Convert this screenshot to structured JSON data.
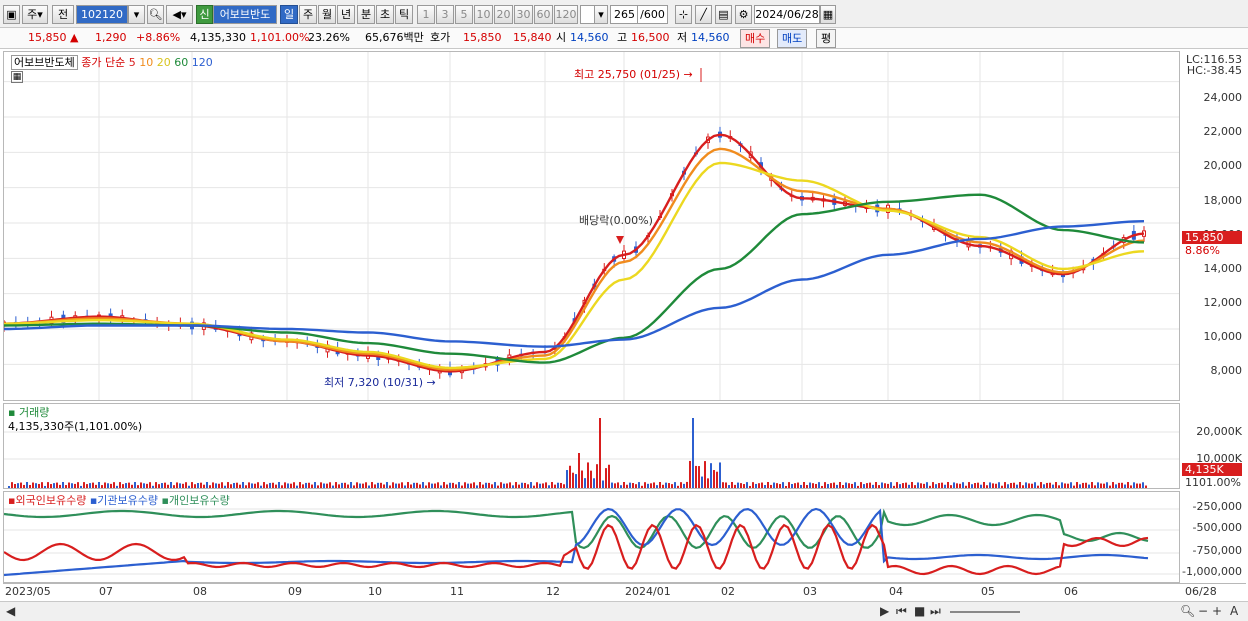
{
  "toolbar": {
    "type_label": "주",
    "period_label": "전",
    "code_value": "102120",
    "sin_label": "신",
    "stock_name": "어보브반도",
    "periods": [
      "일",
      "주",
      "월",
      "년",
      "분",
      "초",
      "틱"
    ],
    "intervals": [
      "1",
      "3",
      "5",
      "10",
      "20",
      "30",
      "60",
      "120"
    ],
    "count_value": "265",
    "count_max": "/600",
    "date_value": "2024/06/28"
  },
  "quote": {
    "price": "15,850 ▲",
    "change": "1,290",
    "change_pct": "+8.86%",
    "volume": "4,135,330",
    "volume_pct": "1,101.00%",
    "turnover_pct": "23.26%",
    "amount": "65,676백만",
    "hoga_label": "호가",
    "ask": "15,850",
    "bid": "15,840",
    "open_label": "시",
    "open": "14,560",
    "high_label": "고",
    "high": "16,500",
    "low_label": "저",
    "low": "14,560",
    "buy_label": "매수",
    "sell_label": "매도",
    "eval_label": "평"
  },
  "price_pane": {
    "legend_name": "어보브반도체",
    "legend_close": "종가 단순",
    "ma_labels": [
      "5",
      "10",
      "20",
      "60",
      "120"
    ],
    "ma_colors": [
      "#d81e1e",
      "#f08c1e",
      "#ecd820",
      "#1f8a3a",
      "#2c5fd0"
    ],
    "lc_label": "LC:116.53",
    "hc_label": "HC:-38.45",
    "annot_high": "최고 25,750 (01/25)",
    "annot_div": "배당락(0.00%)",
    "annot_low": "최저 7,320 (10/31)",
    "price_tag": "15,850",
    "pct_tag": "8.86%",
    "y_ticks": [
      "24,000",
      "22,000",
      "20,000",
      "18,000",
      "16,000",
      "14,000",
      "12,000",
      "10,000",
      "8,000"
    ]
  },
  "volume_pane": {
    "title": "거래량",
    "value": "4,135,330주(1,101.00%)",
    "tag": "4,135K",
    "tag_pct": "1101.00%",
    "y_ticks": [
      "20,000K",
      "10,000K"
    ]
  },
  "holding_pane": {
    "legend": [
      "외국인보유수량",
      "기관보유수량",
      "개인보유수량"
    ],
    "legend_colors": [
      "#d81e1e",
      "#2c5fd0",
      "#2f8f5a"
    ],
    "y_ticks": [
      "-250,000",
      "-500,000",
      "-750,000",
      "-1,000,000"
    ]
  },
  "x_axis": {
    "labels": [
      "2023/05",
      "07",
      "08",
      "09",
      "10",
      "11",
      "12",
      "2024/01",
      "02",
      "03",
      "04",
      "05",
      "06",
      "06/28"
    ]
  },
  "chart_data": {
    "type": "line",
    "title": "",
    "ylabel": "",
    "ylim": [
      7000,
      25000
    ],
    "x": [
      "2023/05",
      "07",
      "08",
      "09",
      "10",
      "11",
      "12",
      "2024/01",
      "02",
      "03",
      "04",
      "05",
      "06",
      "06/28"
    ],
    "series": [
      {
        "name": "5",
        "values": [
          10300,
          10700,
          10200,
          9300,
          8500,
          7600,
          8700,
          14200,
          21000,
          17400,
          16800,
          14700,
          13100,
          15400
        ]
      },
      {
        "name": "10",
        "values": [
          10300,
          10600,
          10300,
          9300,
          8600,
          7700,
          8500,
          13800,
          20200,
          17800,
          16800,
          14900,
          13200,
          15000
        ]
      },
      {
        "name": "20",
        "values": [
          10300,
          10500,
          10300,
          9400,
          8700,
          7800,
          8300,
          12800,
          19400,
          18400,
          16700,
          15200,
          13400,
          14400
        ]
      },
      {
        "name": "60",
        "values": [
          10200,
          10300,
          10200,
          9800,
          9200,
          8600,
          8100,
          9500,
          13400,
          16500,
          17200,
          17600,
          15600,
          14900
        ]
      },
      {
        "name": "120",
        "values": [
          10000,
          10200,
          10200,
          10000,
          9800,
          9300,
          9000,
          9400,
          11200,
          12800,
          14200,
          15100,
          15800,
          16100
        ]
      }
    ],
    "annotations": [
      "최고 25,750 (01/25)",
      "배당락(0.00%)",
      "최저 7,320 (10/31)"
    ]
  }
}
